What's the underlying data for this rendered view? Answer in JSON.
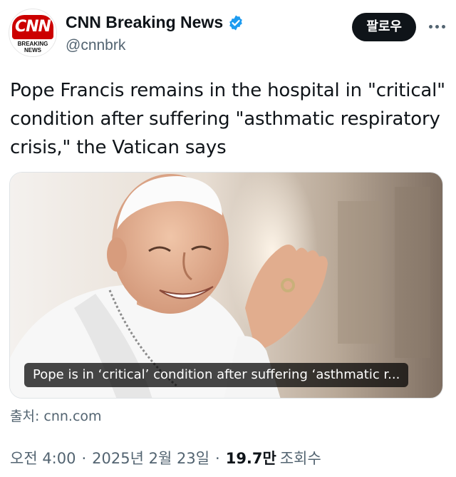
{
  "author": {
    "display_name": "CNN Breaking News",
    "handle": "@cnnbrk",
    "avatar_logo_text": "CNN",
    "avatar_sub_text": "BREAKING NEWS",
    "verified": true,
    "verified_color": "#1d9bf0"
  },
  "header": {
    "follow_label": "팔로우",
    "more_icon": "more-icon"
  },
  "tweet": {
    "text": "Pope Francis remains in the hospital in \"critical\" condition after suffering \"asthmatic respiratory crisis,\" the Vatican says"
  },
  "card": {
    "caption": "Pope is in ‘critical’ condition after suffering ‘asthmatic r...",
    "source_label": "출처: cnn.com"
  },
  "meta": {
    "time": "오전 4:00",
    "separator": "·",
    "date": "2025년 2월 23일",
    "views_count": "19.7만",
    "views_label": "조회수"
  }
}
